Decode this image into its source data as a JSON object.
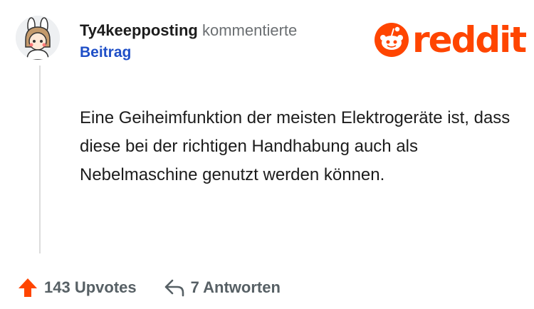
{
  "comment": {
    "author": "Ty4keepposting",
    "action": "kommentierte",
    "post_label": "Beitrag",
    "body": "Eine Geiheimfunktion der meisten Elektrogeräte ist, dass diese bei der richtigen Handhabung auch als Nebelmaschine genutzt werden können.",
    "upvotes_label": "143 Upvotes",
    "replies_label": "7 Antworten"
  },
  "brand": {
    "wordmark": "reddit",
    "color": "#ff4500"
  },
  "icons": {
    "upvote": "arrow-up-icon",
    "reply": "reply-arrow-icon",
    "logo": "reddit-snoo-icon",
    "avatar": "user-avatar-illustration"
  },
  "colors": {
    "author_link": "#1c1c1c",
    "post_link": "#1f4fc7",
    "muted_text": "#6b6f72",
    "upvote": "#ff4500",
    "thread_line": "#dcdcdc"
  }
}
